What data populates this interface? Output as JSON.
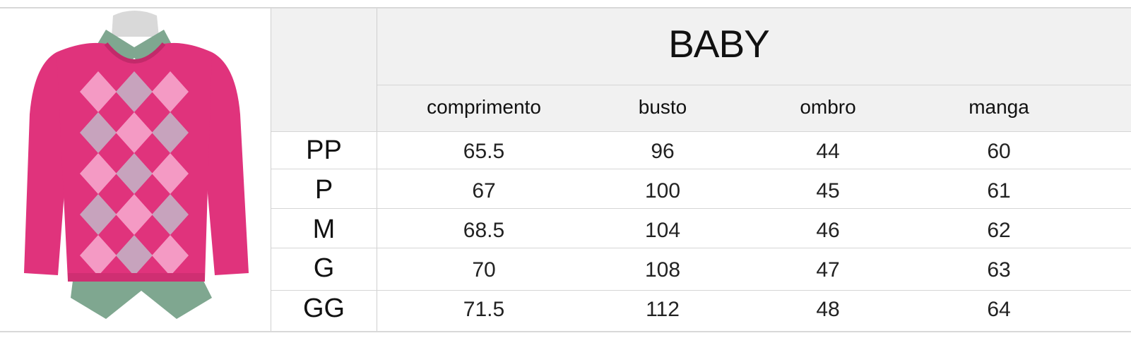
{
  "table": {
    "title": "BABY",
    "columns": [
      "comprimento",
      "busto",
      "ombro",
      "manga"
    ],
    "rows": [
      {
        "size": "PP",
        "values": [
          "65.5",
          "96",
          "44",
          "60"
        ]
      },
      {
        "size": "P",
        "values": [
          "67",
          "100",
          "45",
          "61"
        ]
      },
      {
        "size": "M",
        "values": [
          "68.5",
          "104",
          "46",
          "62"
        ]
      },
      {
        "size": "G",
        "values": [
          "70",
          "108",
          "47",
          "63"
        ]
      },
      {
        "size": "GG",
        "values": [
          "71.5",
          "112",
          "48",
          "64"
        ]
      }
    ]
  },
  "image": {
    "icon": "sweater-illustration",
    "colors": {
      "sweater": "#e0337c",
      "diamond_light": "#f49ac4",
      "diamond_grey": "#c7a3bd",
      "shirt": "#7fa790",
      "mannequin": "#d9d9d9"
    }
  }
}
